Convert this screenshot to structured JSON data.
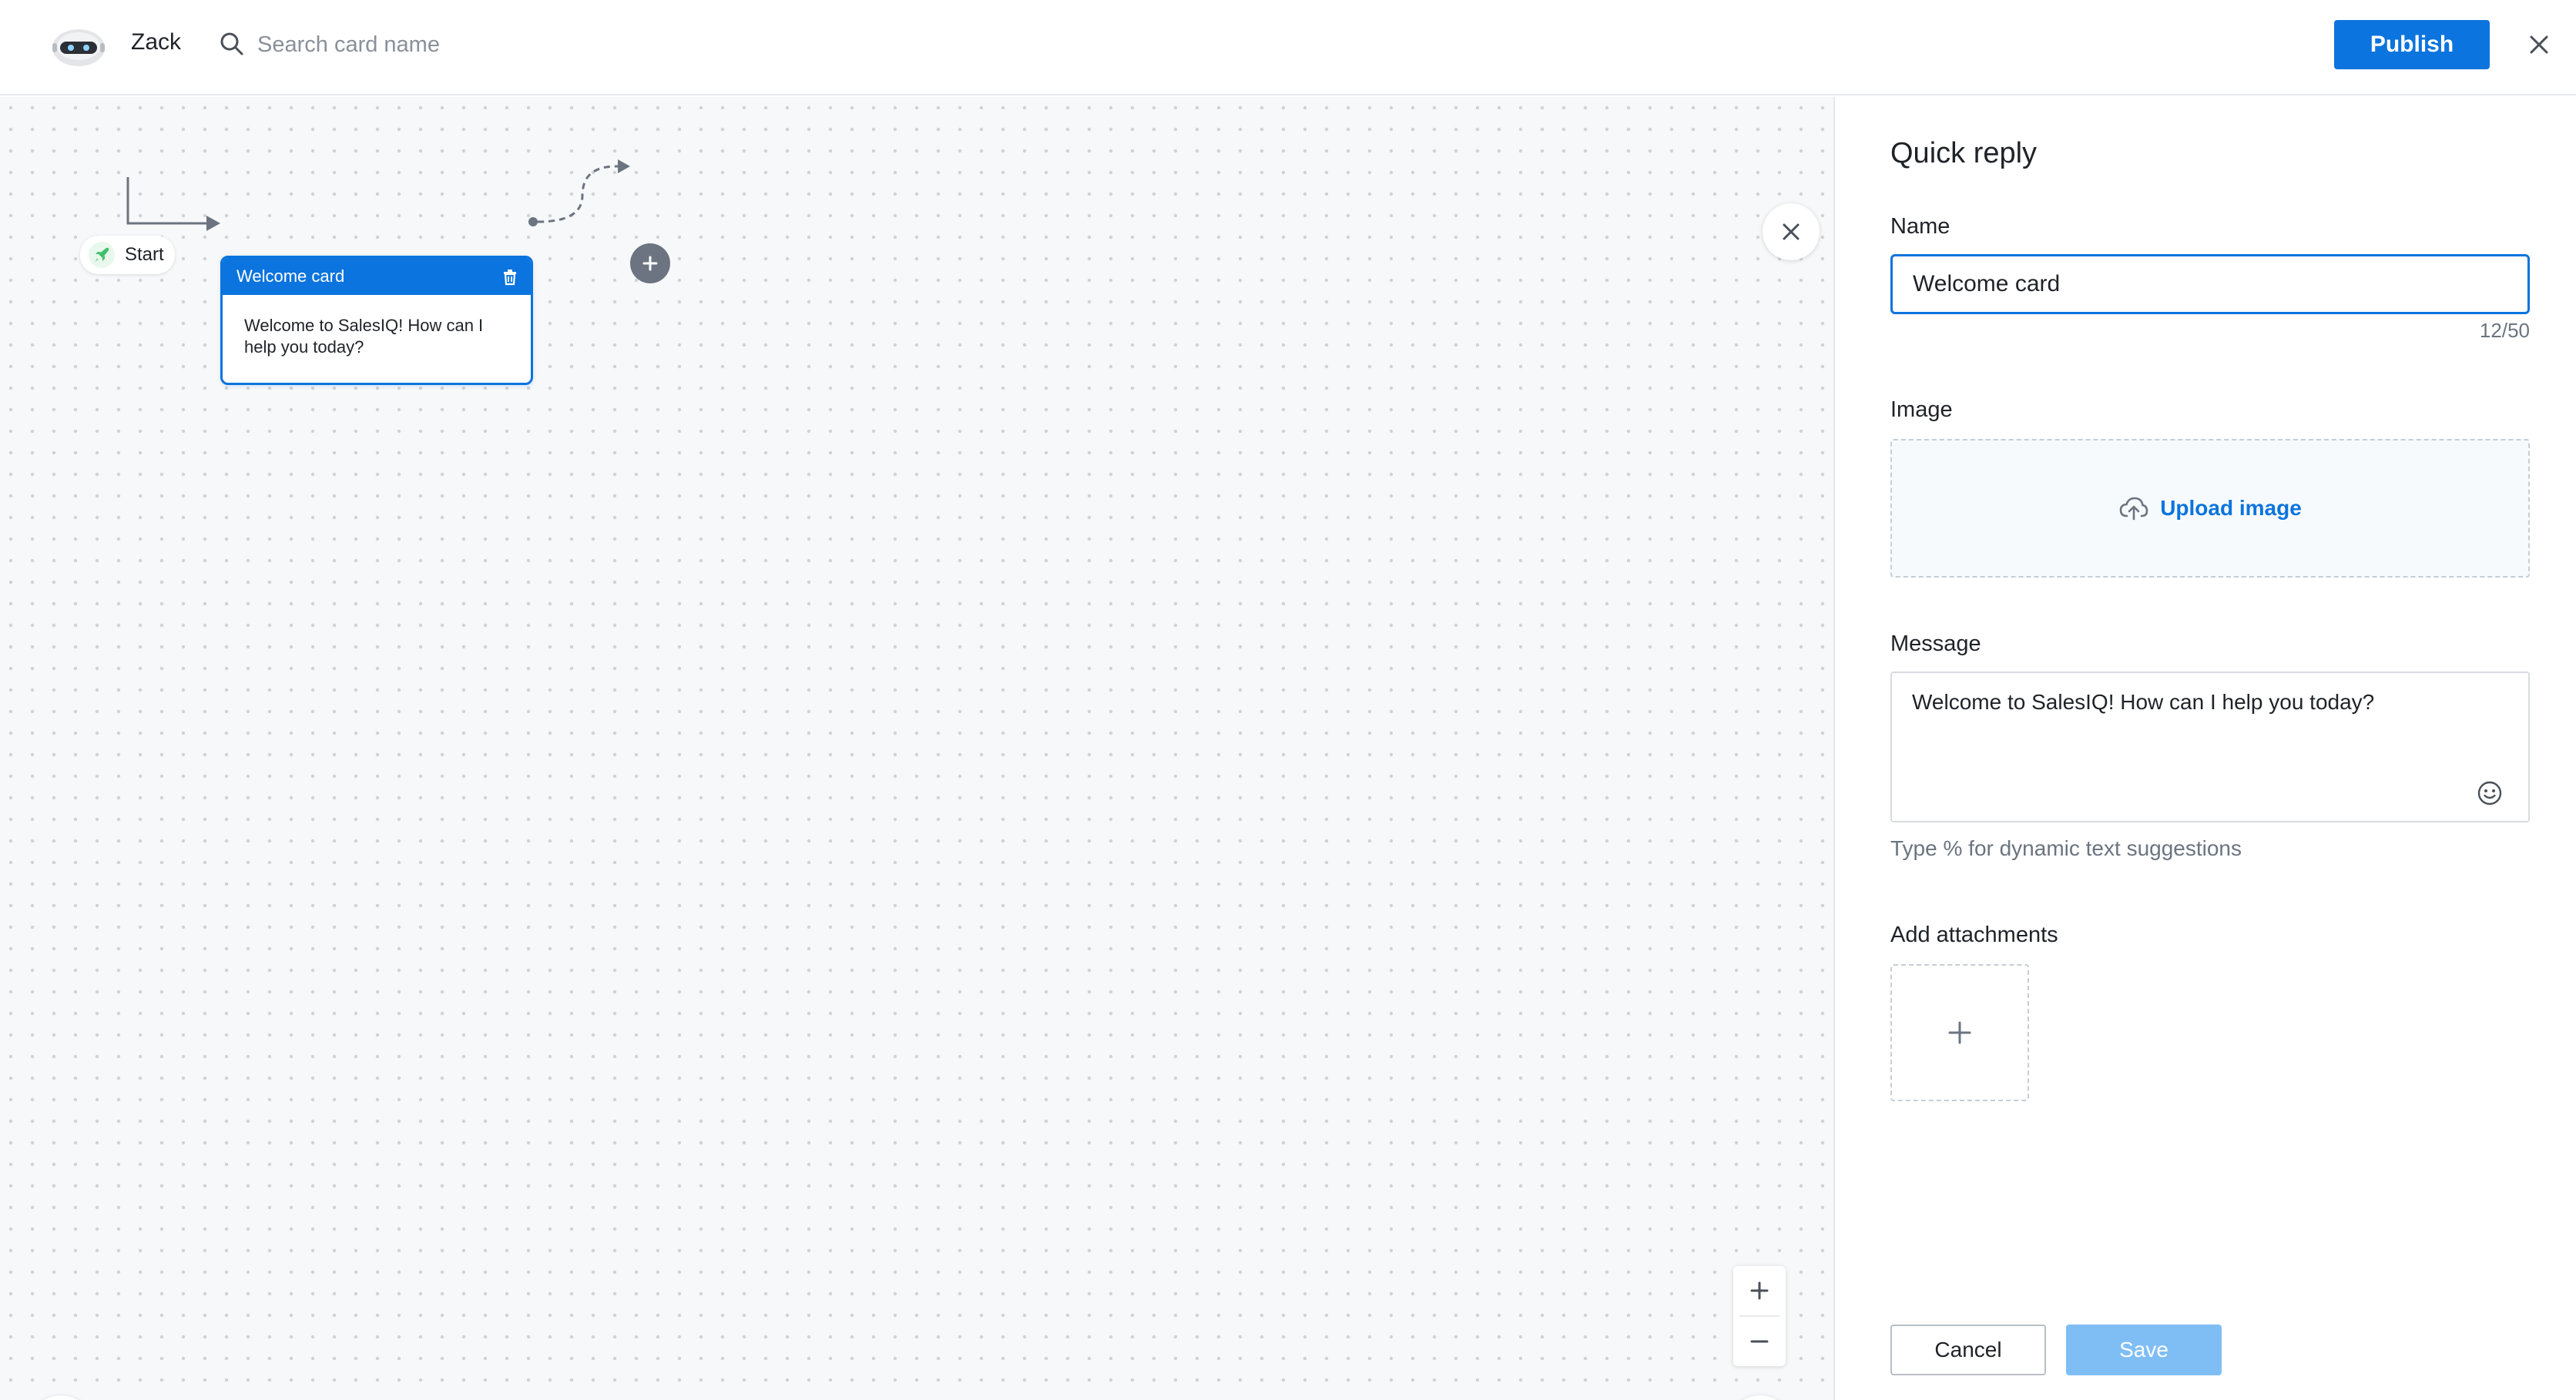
{
  "header": {
    "bot_name": "Zack",
    "search_placeholder": "Search card name",
    "publish_label": "Publish",
    "avatar_icon": "robot-avatar",
    "close_icon": "close-icon"
  },
  "canvas": {
    "start_label": "Start",
    "card": {
      "title": "Welcome card",
      "body": "Welcome to SalesIQ! How can I help you today?"
    },
    "icons": [
      "rocket-icon",
      "trash-icon",
      "plus-icon",
      "close-icon",
      "zoom-in-icon",
      "zoom-out-icon",
      "refresh-icon",
      "eye-icon"
    ]
  },
  "panel": {
    "title": "Quick reply",
    "name_label": "Name",
    "name_value": "Welcome card",
    "name_counter": "12/50",
    "image_label": "Image",
    "upload_label": "Upload image",
    "message_label": "Message",
    "message_value": "Welcome to SalesIQ! How can I help you today?",
    "message_hint": "Type % for dynamic text suggestions",
    "attachments_label": "Add attachments",
    "cancel_label": "Cancel",
    "save_label": "Save"
  },
  "colors": {
    "accent": "#0b74de",
    "save_disabled": "#7fbef5",
    "add_node": "#6b7480"
  }
}
